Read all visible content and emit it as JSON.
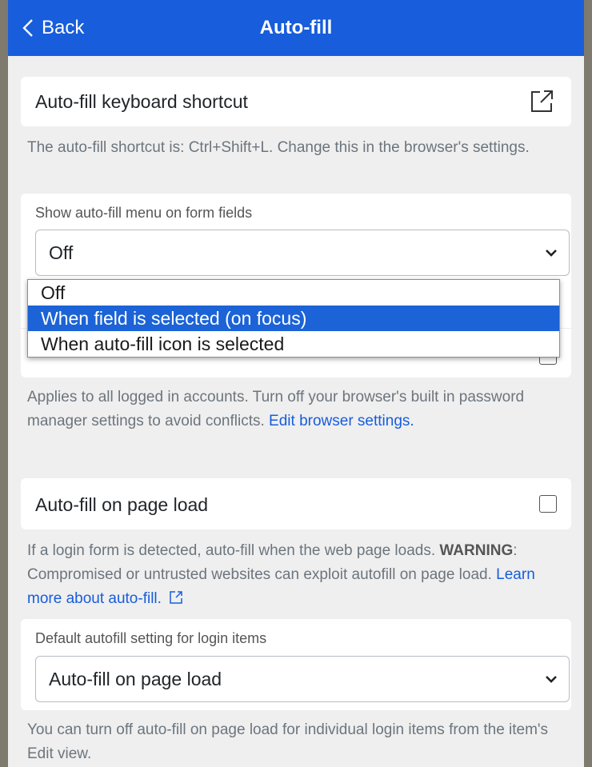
{
  "header": {
    "back_label": "Back",
    "title": "Auto-fill"
  },
  "shortcut": {
    "label": "Auto-fill keyboard shortcut",
    "help": "The auto-fill shortcut is: Ctrl+Shift+L. Change this in the browser's settings."
  },
  "menu_setting": {
    "label": "Show auto-fill menu on form fields",
    "selected": "Off",
    "options": [
      "Off",
      "When field is selected (on focus)",
      "When auto-fill icon is selected"
    ],
    "highlighted_index": 1
  },
  "default_manager": {
    "help_prefix": "Applies to all logged in accounts. Turn off your browser's built in password manager settings to avoid conflicts. ",
    "help_link": "Edit browser settings."
  },
  "page_load": {
    "label": "Auto-fill on page load",
    "checked": false,
    "help_prefix": "If a login form is detected, auto-fill when the web page loads. ",
    "help_warning": "WARNING",
    "help_middle": ": Compromised or untrusted websites can exploit autofill on page load. ",
    "help_link": "Learn more about auto-fill."
  },
  "default_login": {
    "label": "Default autofill setting for login items",
    "selected": "Auto-fill on page load",
    "help": "You can turn off auto-fill on page load for individual login items from the item's Edit view."
  },
  "colors": {
    "header_bg": "#175ddc",
    "link": "#175ddc",
    "highlight": "#1b63d6"
  }
}
